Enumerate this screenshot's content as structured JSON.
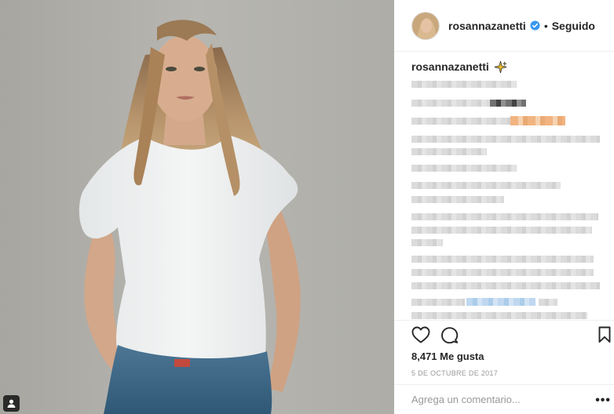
{
  "post": {
    "photo_icon": "person-illustration",
    "tag_icon": "user-tag-icon"
  },
  "header": {
    "username": "rosannazanetti",
    "verified_icon": "verified-badge-icon",
    "separator": "•",
    "follow_status": "Seguido",
    "accent": "#3897f0"
  },
  "caption": {
    "username": "rosannazanetti",
    "sparkle_icon": "sparkle-emoji-icon"
  },
  "actions": {
    "like_icon": "heart-icon",
    "comment_icon": "comment-bubble-icon",
    "save_icon": "bookmark-icon"
  },
  "likes": "8,471 Me gusta",
  "date": "5 DE OCTUBRE DE 2017",
  "comment": {
    "placeholder": "Agrega un comentario...",
    "more": "•••"
  }
}
